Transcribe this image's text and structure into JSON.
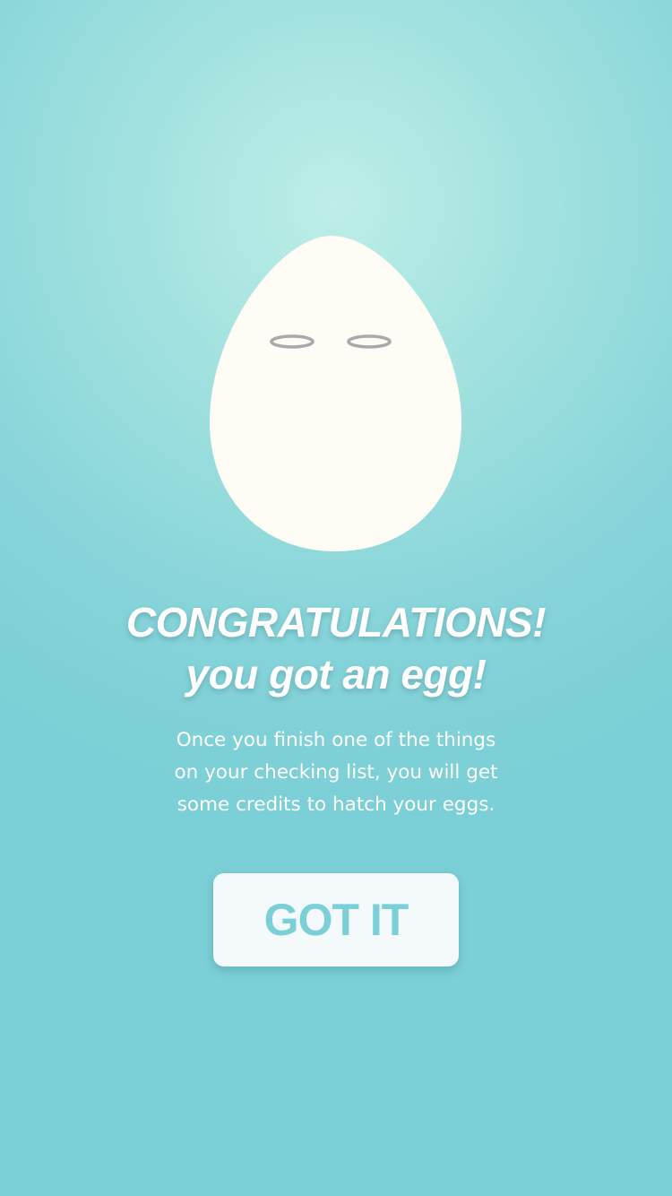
{
  "colors": {
    "background": "#7bcfd6",
    "background_glow": "#bdeee7",
    "egg": "#fffcf5",
    "egg_eyes": "#aaa8ab",
    "button_background": "#f4fafc",
    "button_text": "#7bcfd6",
    "text": "#ffffff"
  },
  "hero": {
    "icon": "egg-icon"
  },
  "headline": {
    "line1": "CONGRATULATIONS!",
    "line2": "you got an egg!"
  },
  "description": {
    "line1": "Once you finish one of the things",
    "line2": "on your checking list, you will get",
    "line3": "some credits to hatch your eggs."
  },
  "actions": {
    "got_it_label": "GOT IT"
  }
}
